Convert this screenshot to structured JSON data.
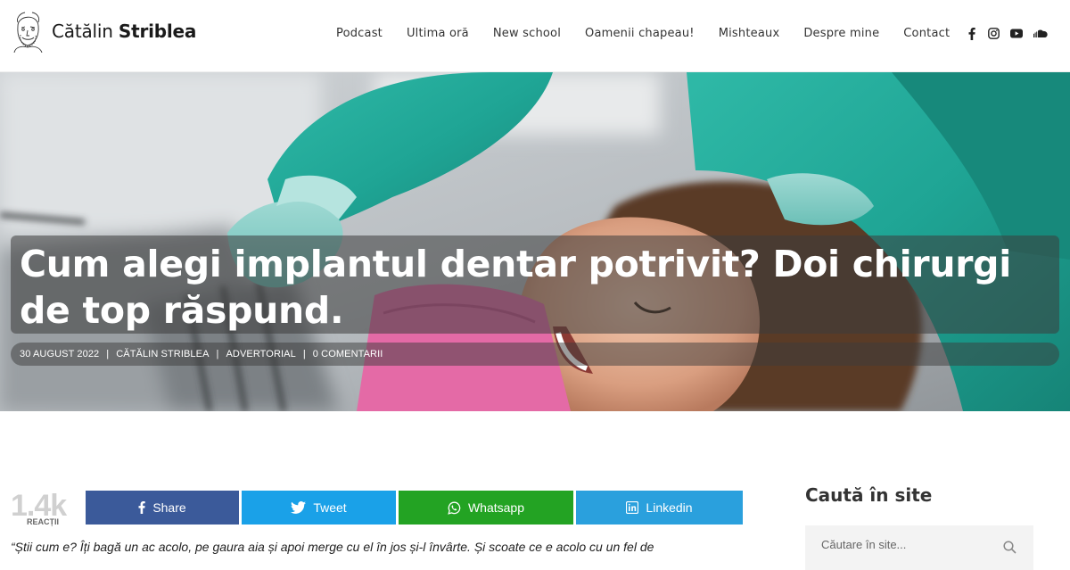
{
  "site": {
    "name_first": "Cătălin ",
    "name_last": "Striblea"
  },
  "nav": {
    "items": [
      "Podcast",
      "Ultima oră",
      "New school",
      "Oamenii chapeau!",
      "Mishteaux",
      "Despre mine",
      "Contact"
    ]
  },
  "social": [
    "facebook-icon",
    "instagram-icon",
    "youtube-icon",
    "soundcloud-icon"
  ],
  "article": {
    "title": "Cum alegi implantul dentar potrivit? Doi chirurgi de top răspund.",
    "date": "30 AUGUST 2022",
    "author": "CĂTĂLIN STRIBLEA",
    "category": "ADVERTORIAL",
    "comments": "0 COMENTARII",
    "sep": "|",
    "excerpt": "“Știi cum e? Îți bagă un ac acolo, pe gaura aia și apoi merge cu el în jos și-l învârte. Și scoate ce e acolo cu un fel de"
  },
  "share": {
    "count": "1.4k",
    "count_label": "REACȚII",
    "facebook": "Share",
    "twitter": "Tweet",
    "whatsapp": "Whatsapp",
    "linkedin": "Linkedin"
  },
  "sidebar": {
    "search_title": "Caută în site",
    "search_placeholder": "Căutare în site..."
  },
  "colors": {
    "facebook": "#3b5a9a",
    "twitter": "#1aa1e8",
    "whatsapp": "#23a323",
    "linkedin": "#2aa0dd"
  }
}
